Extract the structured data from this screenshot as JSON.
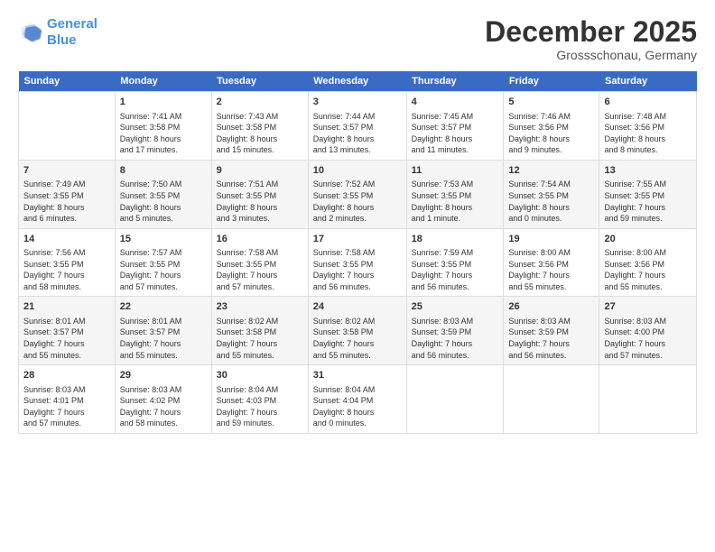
{
  "logo": {
    "line1": "General",
    "line2": "Blue"
  },
  "title": "December 2025",
  "subtitle": "Grossschonau, Germany",
  "headers": [
    "Sunday",
    "Monday",
    "Tuesday",
    "Wednesday",
    "Thursday",
    "Friday",
    "Saturday"
  ],
  "rows": [
    [
      {
        "day": "",
        "info": ""
      },
      {
        "day": "1",
        "info": "Sunrise: 7:41 AM\nSunset: 3:58 PM\nDaylight: 8 hours\nand 17 minutes."
      },
      {
        "day": "2",
        "info": "Sunrise: 7:43 AM\nSunset: 3:58 PM\nDaylight: 8 hours\nand 15 minutes."
      },
      {
        "day": "3",
        "info": "Sunrise: 7:44 AM\nSunset: 3:57 PM\nDaylight: 8 hours\nand 13 minutes."
      },
      {
        "day": "4",
        "info": "Sunrise: 7:45 AM\nSunset: 3:57 PM\nDaylight: 8 hours\nand 11 minutes."
      },
      {
        "day": "5",
        "info": "Sunrise: 7:46 AM\nSunset: 3:56 PM\nDaylight: 8 hours\nand 9 minutes."
      },
      {
        "day": "6",
        "info": "Sunrise: 7:48 AM\nSunset: 3:56 PM\nDaylight: 8 hours\nand 8 minutes."
      }
    ],
    [
      {
        "day": "7",
        "info": "Sunrise: 7:49 AM\nSunset: 3:55 PM\nDaylight: 8 hours\nand 6 minutes."
      },
      {
        "day": "8",
        "info": "Sunrise: 7:50 AM\nSunset: 3:55 PM\nDaylight: 8 hours\nand 5 minutes."
      },
      {
        "day": "9",
        "info": "Sunrise: 7:51 AM\nSunset: 3:55 PM\nDaylight: 8 hours\nand 3 minutes."
      },
      {
        "day": "10",
        "info": "Sunrise: 7:52 AM\nSunset: 3:55 PM\nDaylight: 8 hours\nand 2 minutes."
      },
      {
        "day": "11",
        "info": "Sunrise: 7:53 AM\nSunset: 3:55 PM\nDaylight: 8 hours\nand 1 minute."
      },
      {
        "day": "12",
        "info": "Sunrise: 7:54 AM\nSunset: 3:55 PM\nDaylight: 8 hours\nand 0 minutes."
      },
      {
        "day": "13",
        "info": "Sunrise: 7:55 AM\nSunset: 3:55 PM\nDaylight: 7 hours\nand 59 minutes."
      }
    ],
    [
      {
        "day": "14",
        "info": "Sunrise: 7:56 AM\nSunset: 3:55 PM\nDaylight: 7 hours\nand 58 minutes."
      },
      {
        "day": "15",
        "info": "Sunrise: 7:57 AM\nSunset: 3:55 PM\nDaylight: 7 hours\nand 57 minutes."
      },
      {
        "day": "16",
        "info": "Sunrise: 7:58 AM\nSunset: 3:55 PM\nDaylight: 7 hours\nand 57 minutes."
      },
      {
        "day": "17",
        "info": "Sunrise: 7:58 AM\nSunset: 3:55 PM\nDaylight: 7 hours\nand 56 minutes."
      },
      {
        "day": "18",
        "info": "Sunrise: 7:59 AM\nSunset: 3:55 PM\nDaylight: 7 hours\nand 56 minutes."
      },
      {
        "day": "19",
        "info": "Sunrise: 8:00 AM\nSunset: 3:56 PM\nDaylight: 7 hours\nand 55 minutes."
      },
      {
        "day": "20",
        "info": "Sunrise: 8:00 AM\nSunset: 3:56 PM\nDaylight: 7 hours\nand 55 minutes."
      }
    ],
    [
      {
        "day": "21",
        "info": "Sunrise: 8:01 AM\nSunset: 3:57 PM\nDaylight: 7 hours\nand 55 minutes."
      },
      {
        "day": "22",
        "info": "Sunrise: 8:01 AM\nSunset: 3:57 PM\nDaylight: 7 hours\nand 55 minutes."
      },
      {
        "day": "23",
        "info": "Sunrise: 8:02 AM\nSunset: 3:58 PM\nDaylight: 7 hours\nand 55 minutes."
      },
      {
        "day": "24",
        "info": "Sunrise: 8:02 AM\nSunset: 3:58 PM\nDaylight: 7 hours\nand 55 minutes."
      },
      {
        "day": "25",
        "info": "Sunrise: 8:03 AM\nSunset: 3:59 PM\nDaylight: 7 hours\nand 56 minutes."
      },
      {
        "day": "26",
        "info": "Sunrise: 8:03 AM\nSunset: 3:59 PM\nDaylight: 7 hours\nand 56 minutes."
      },
      {
        "day": "27",
        "info": "Sunrise: 8:03 AM\nSunset: 4:00 PM\nDaylight: 7 hours\nand 57 minutes."
      }
    ],
    [
      {
        "day": "28",
        "info": "Sunrise: 8:03 AM\nSunset: 4:01 PM\nDaylight: 7 hours\nand 57 minutes."
      },
      {
        "day": "29",
        "info": "Sunrise: 8:03 AM\nSunset: 4:02 PM\nDaylight: 7 hours\nand 58 minutes."
      },
      {
        "day": "30",
        "info": "Sunrise: 8:04 AM\nSunset: 4:03 PM\nDaylight: 7 hours\nand 59 minutes."
      },
      {
        "day": "31",
        "info": "Sunrise: 8:04 AM\nSunset: 4:04 PM\nDaylight: 8 hours\nand 0 minutes."
      },
      {
        "day": "",
        "info": ""
      },
      {
        "day": "",
        "info": ""
      },
      {
        "day": "",
        "info": ""
      }
    ]
  ]
}
